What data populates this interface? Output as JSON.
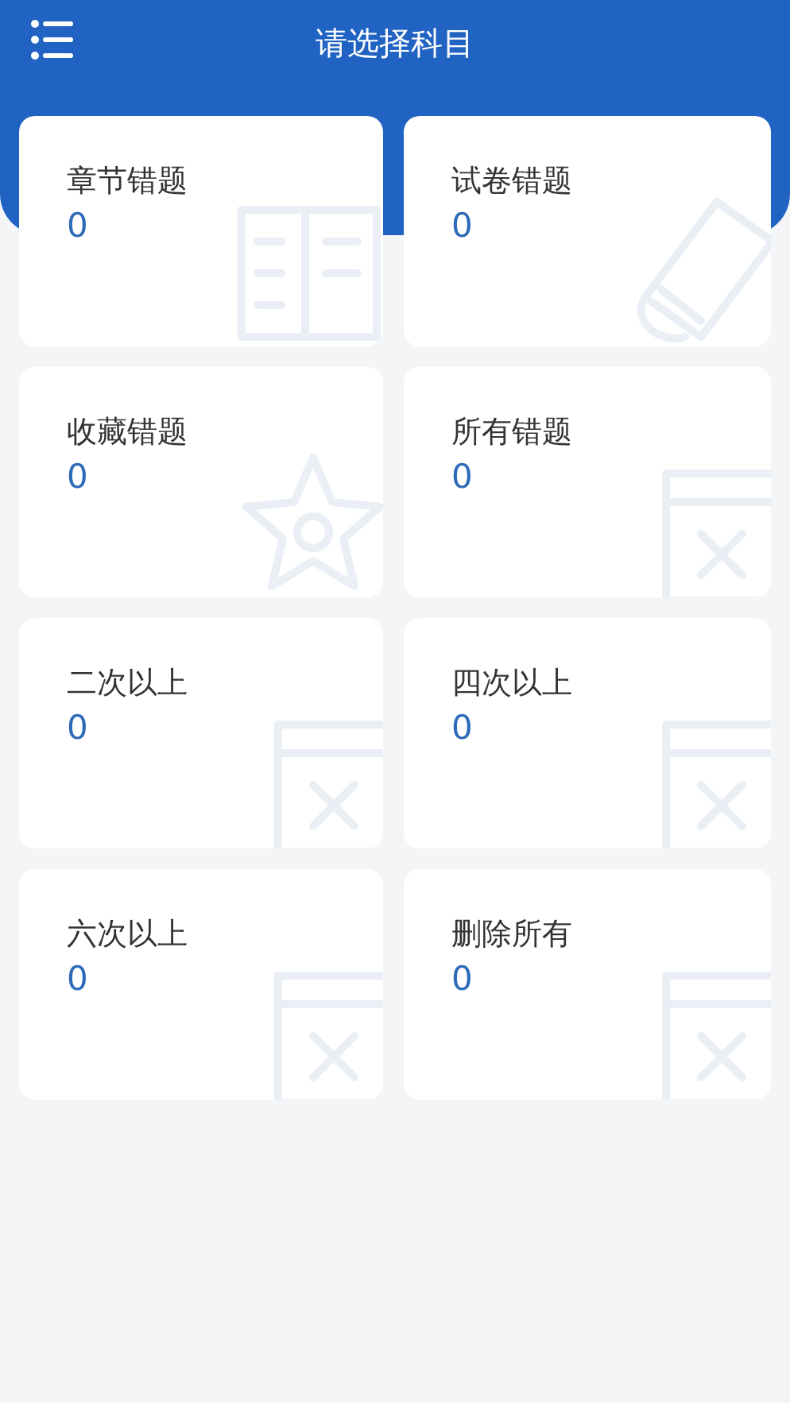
{
  "header": {
    "title": "请选择科目"
  },
  "cards": [
    {
      "label": "章节错题",
      "count": "0",
      "kind": "book"
    },
    {
      "label": "试卷错题",
      "count": "0",
      "kind": "scroll"
    },
    {
      "label": "收藏错题",
      "count": "0",
      "kind": "star"
    },
    {
      "label": "所有错题",
      "count": "0",
      "kind": "window"
    },
    {
      "label": "二次以上",
      "count": "0",
      "kind": "window"
    },
    {
      "label": "四次以上",
      "count": "0",
      "kind": "window"
    },
    {
      "label": "六次以上",
      "count": "0",
      "kind": "window"
    },
    {
      "label": "删除所有",
      "count": "0",
      "kind": "window"
    }
  ]
}
